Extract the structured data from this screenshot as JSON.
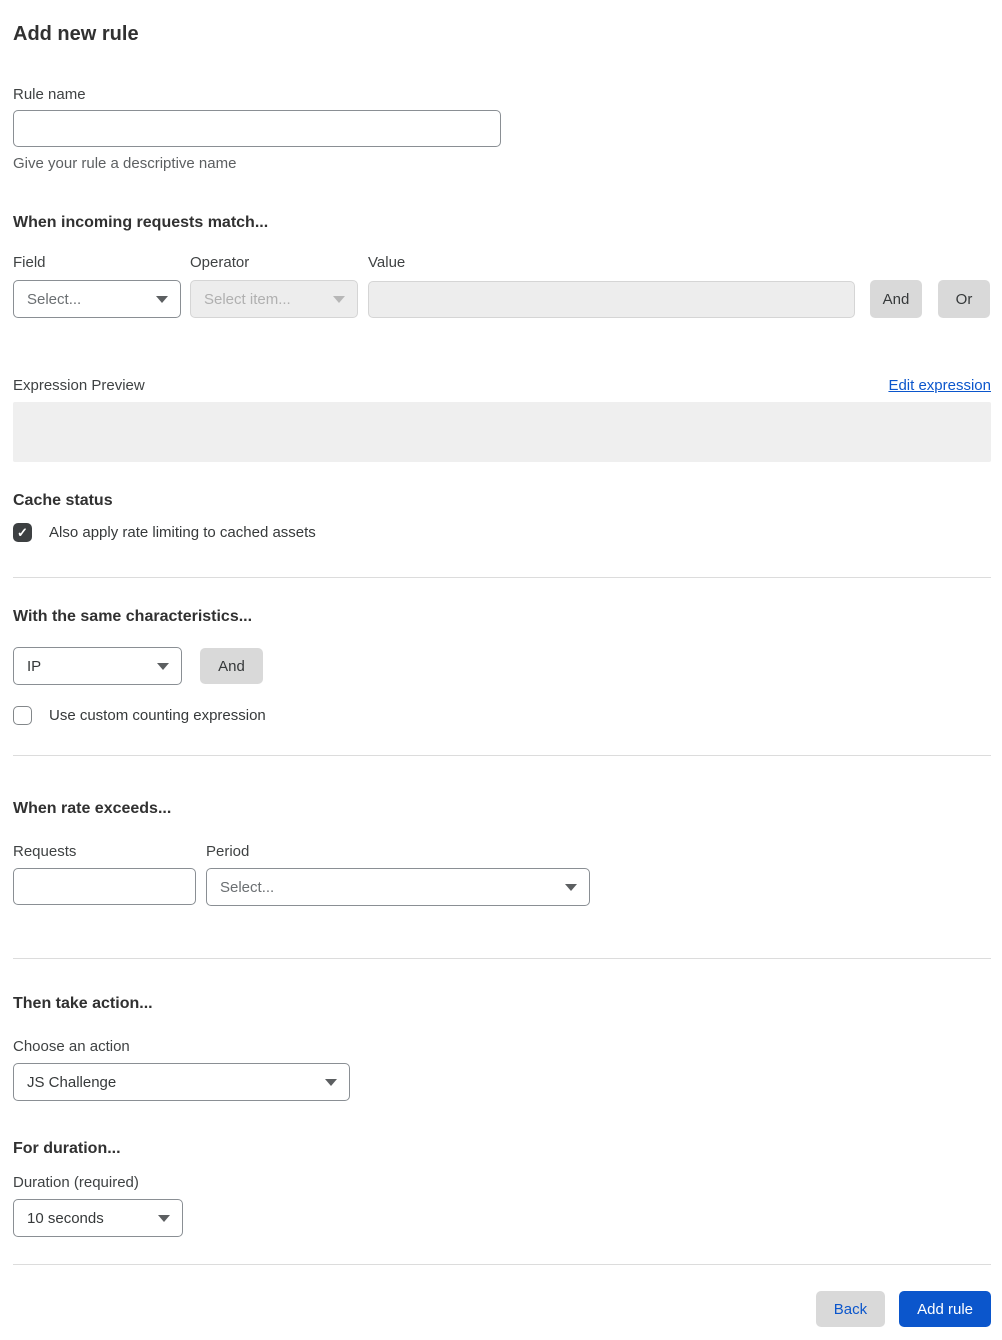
{
  "page": {
    "title": "Add new rule"
  },
  "rule_name": {
    "label": "Rule name",
    "value": "",
    "helper": "Give your rule a descriptive name"
  },
  "match_section": {
    "heading": "When incoming requests match...",
    "field": {
      "label": "Field",
      "value": "Select..."
    },
    "operator": {
      "label": "Operator",
      "value": "Select item..."
    },
    "value": {
      "label": "Value",
      "value": ""
    },
    "and_button": "And",
    "or_button": "Or",
    "expression_preview_label": "Expression Preview",
    "edit_expression_link": "Edit expression",
    "expression_value": ""
  },
  "cache_status": {
    "heading": "Cache status",
    "checkbox_label": "Also apply rate limiting to cached assets",
    "checked": true
  },
  "characteristics": {
    "heading": "With the same characteristics...",
    "select_value": "IP",
    "and_button": "And",
    "custom_counting_label": "Use custom counting expression",
    "custom_counting_checked": false
  },
  "rate": {
    "heading": "When rate exceeds...",
    "requests_label": "Requests",
    "requests_value": "",
    "period_label": "Period",
    "period_value": "Select..."
  },
  "action": {
    "heading": "Then take action...",
    "choose_label": "Choose an action",
    "selected": "JS Challenge"
  },
  "duration": {
    "heading": "For duration...",
    "label": "Duration (required)",
    "selected": "10 seconds"
  },
  "footer": {
    "back_label": "Back",
    "add_rule_label": "Add rule"
  },
  "icons": {
    "check": "✓"
  },
  "colors": {
    "accent_blue": "#0b56cc",
    "text_dark": "#36393a",
    "helper_gray": "#5c5f61",
    "border_gray": "#8a8f94",
    "disabled_bg": "#ededed",
    "gray_button": "#d9d9d9",
    "divider": "#dcdcdc",
    "expression_box_bg": "#efefef",
    "checkbox_checked_bg": "#3d4042"
  }
}
